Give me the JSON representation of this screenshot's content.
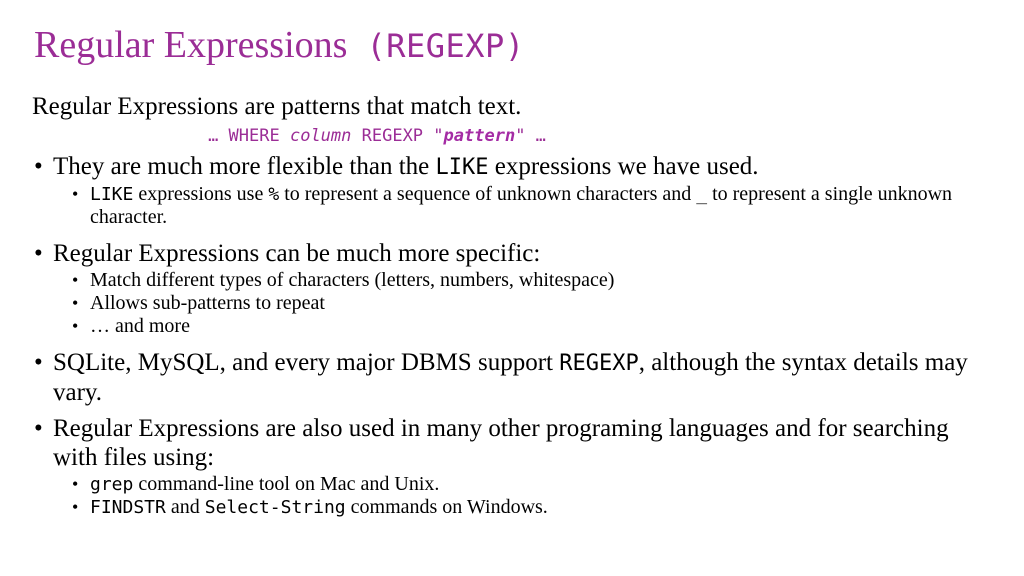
{
  "slide": {
    "title": {
      "main": "Regular Expressions",
      "code": "(REGEXP)",
      "color": "#9b2d96"
    },
    "lead": "Regular Expressions are patterns that match text.",
    "syntax": {
      "prefix": "… WHERE ",
      "column": "column",
      "keyword": " REGEXP ",
      "quote_open": "\"",
      "pattern": "pattern",
      "quote_close": "\"",
      "suffix": " …",
      "color": "#9b2d96",
      "pattern_color": "#a42ba4"
    },
    "bullets": [
      {
        "bullet": "•",
        "parts": [
          {
            "text": "They are much more flexible than the ",
            "style": "serif"
          },
          {
            "text": "LIKE",
            "style": "mono"
          },
          {
            "text": " expressions we have used.",
            "style": "serif"
          }
        ],
        "sub": [
          {
            "bullet": "•",
            "parts": [
              {
                "text": "LIKE",
                "style": "mono"
              },
              {
                "text": " expressions use ",
                "style": "serif"
              },
              {
                "text": "%",
                "style": "mono"
              },
              {
                "text": " to represent a sequence of unknown characters and ",
                "style": "serif"
              },
              {
                "text": "_",
                "style": "mono"
              },
              {
                "text": " to represent a single unknown character.",
                "style": "serif"
              }
            ]
          }
        ]
      },
      {
        "bullet": "•",
        "parts": [
          {
            "text": "Regular Expressions can be much more specific:",
            "style": "serif"
          }
        ],
        "sub": [
          {
            "bullet": "•",
            "parts": [
              {
                "text": "Match different types of characters (letters, numbers, whitespace)",
                "style": "serif"
              }
            ]
          },
          {
            "bullet": "•",
            "parts": [
              {
                "text": "Allows sub-patterns to repeat",
                "style": "serif"
              }
            ]
          },
          {
            "bullet": "•",
            "parts": [
              {
                "text": "… and more",
                "style": "serif"
              }
            ]
          }
        ]
      },
      {
        "bullet": "•",
        "parts": [
          {
            "text": "SQLite, MySQL, and every major DBMS support ",
            "style": "serif"
          },
          {
            "text": "REGEXP",
            "style": "mono"
          },
          {
            "text": ", although the syntax details may vary.",
            "style": "serif"
          }
        ],
        "sub": []
      },
      {
        "bullet": "•",
        "parts": [
          {
            "text": "Regular Expressions are also used in many other programing languages and for searching with files using:",
            "style": "serif"
          }
        ],
        "sub": [
          {
            "bullet": "•",
            "parts": [
              {
                "text": "grep",
                "style": "mono"
              },
              {
                "text": " command-line tool on Mac and Unix.",
                "style": "serif"
              }
            ]
          },
          {
            "bullet": "•",
            "parts": [
              {
                "text": "FINDSTR",
                "style": "mono"
              },
              {
                "text": " and ",
                "style": "serif"
              },
              {
                "text": "Select-String",
                "style": "mono"
              },
              {
                "text": " commands on Windows.",
                "style": "serif"
              }
            ]
          }
        ]
      }
    ]
  }
}
